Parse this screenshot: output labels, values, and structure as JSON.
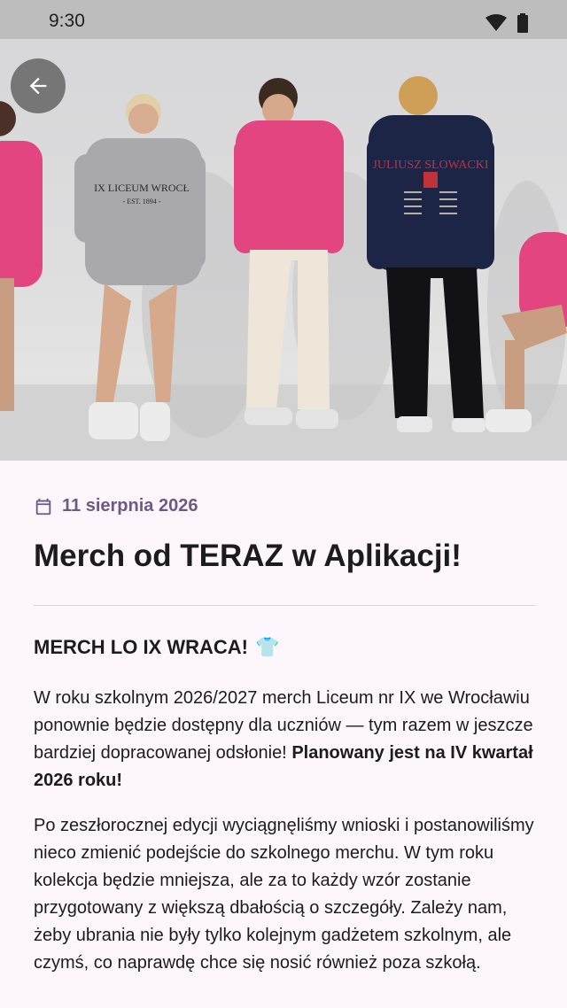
{
  "status_bar": {
    "time": "9:30",
    "icons": [
      "wifi-icon",
      "battery-icon"
    ]
  },
  "hero": {
    "icon": "back-arrow-icon"
  },
  "article": {
    "date": "11 sierpnia 2026",
    "date_icon": "calendar-icon",
    "title": "Merch od TERAZ w Aplikacji!",
    "heading": "MERCH LO IX WRACA!",
    "heading_emoji": "👕",
    "paragraph1_text": "W roku szkolnym 2026/2027 merch Liceum nr IX we Wrocławiu ponownie będzie dostępny dla uczniów — tym razem w jeszcze bardziej dopracowanej odsłonie! ",
    "paragraph1_bold": "Planowany jest na IV kwartał 2026 roku!",
    "paragraph2": "Po zeszłorocznej edycji wyciągnęliśmy wnioski i postanowiliśmy nieco zmienić podejście do szkolnego merchu. W tym roku kolekcja będzie mniejsza, ale za to każdy wzór zostanie przygotowany z większą dbałością o szczegóły. Zależy nam, żeby ubrania nie były tylko kolejnym gadżetem szkolnym, ale czymś, co naprawdę chce się nosić również poza szkołą."
  },
  "colors": {
    "accent": "#6b5a86",
    "pink": "#e2457f",
    "navy": "#1d2547"
  }
}
